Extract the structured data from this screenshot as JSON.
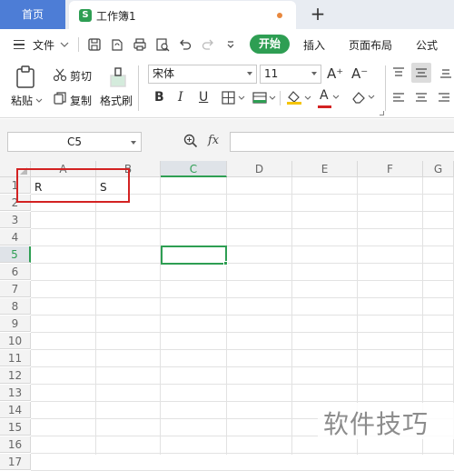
{
  "tabs": {
    "home": "首页",
    "workbook_logo": "S",
    "workbook": "工作簿1",
    "add": "+"
  },
  "menu": {
    "file": "文件",
    "start": "开始",
    "insert": "插入",
    "page_layout": "页面布局",
    "formulas": "公式"
  },
  "ribbon": {
    "paste": "粘贴",
    "cut": "剪切",
    "copy": "复制",
    "format_painter": "格式刷",
    "font_name": "宋体",
    "font_size": "11",
    "grow_font": "A⁺",
    "shrink_font": "A⁻",
    "bold": "B",
    "italic": "I",
    "underline": "U",
    "font_color_letter": "A"
  },
  "formula_bar": {
    "name_box": "C5",
    "fx": "fx",
    "formula": ""
  },
  "sheet": {
    "columns": [
      "A",
      "B",
      "C",
      "D",
      "E",
      "F",
      "G"
    ],
    "rows": [
      "1",
      "2",
      "3",
      "4",
      "5",
      "6",
      "7",
      "8",
      "9",
      "10",
      "11",
      "12",
      "13",
      "14",
      "15",
      "16",
      "17"
    ],
    "active_column": "C",
    "active_row": "5",
    "cells": {
      "A1": "R",
      "B1": "S"
    }
  },
  "watermark": "软件技巧",
  "colors": {
    "accent": "#2e9e53",
    "home_tab": "#4d7dd6",
    "highlight": "#d32222"
  }
}
